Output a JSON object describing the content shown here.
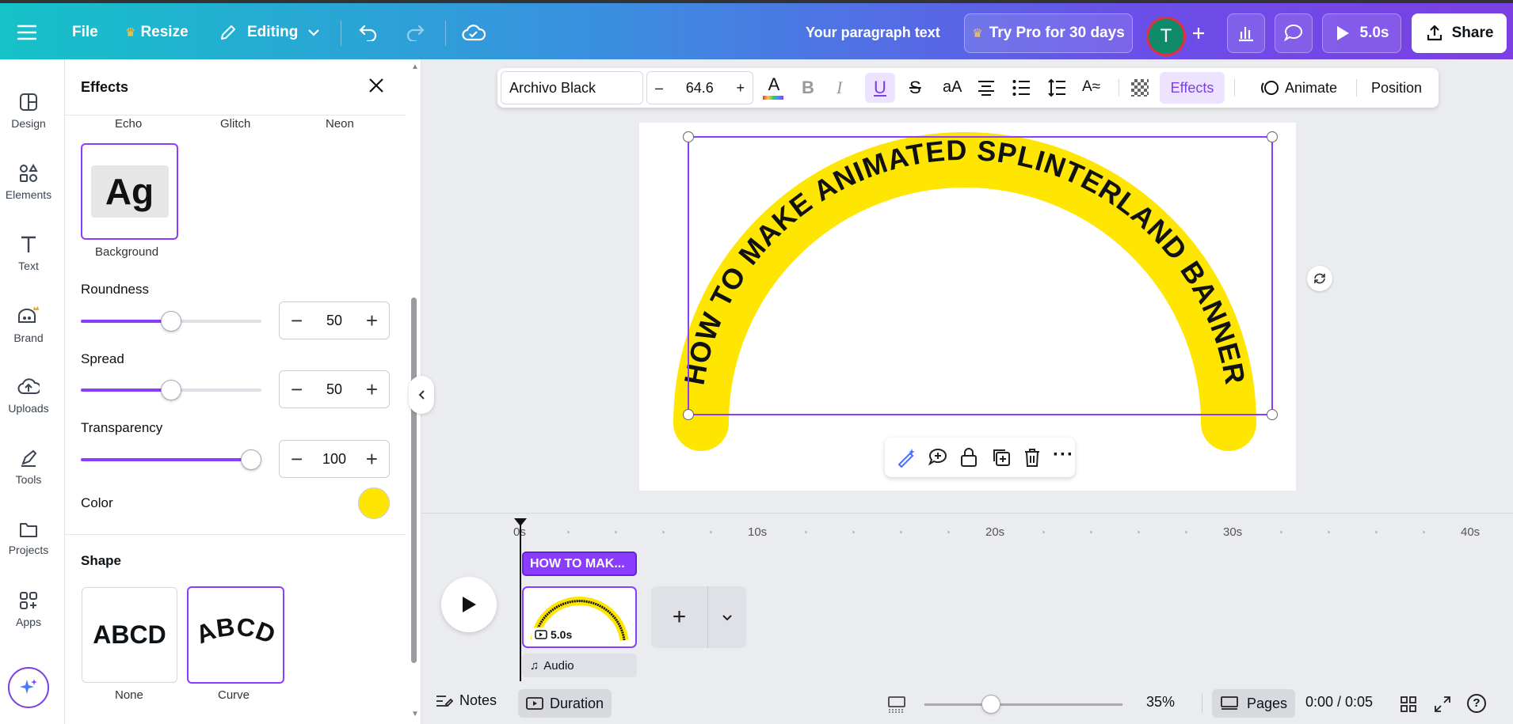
{
  "topbar": {
    "menu_icon": "hamburger-icon",
    "file_label": "File",
    "resize_label": "Resize",
    "editing_label": "Editing",
    "doc_title": "Your paragraph text",
    "try_pro_label": "Try Pro for 30 days",
    "avatar_letter": "T",
    "play_duration": "5.0s",
    "share_label": "Share"
  },
  "rail": {
    "items": [
      {
        "label": "Design",
        "icon": "design-icon"
      },
      {
        "label": "Elements",
        "icon": "elements-icon"
      },
      {
        "label": "Text",
        "icon": "text-icon"
      },
      {
        "label": "Brand",
        "icon": "brand-icon"
      },
      {
        "label": "Uploads",
        "icon": "uploads-icon"
      },
      {
        "label": "Tools",
        "icon": "tools-icon"
      },
      {
        "label": "Projects",
        "icon": "projects-icon"
      },
      {
        "label": "Apps",
        "icon": "apps-icon"
      }
    ]
  },
  "panel": {
    "title": "Effects",
    "styles_row": [
      "Echo",
      "Glitch",
      "Neon"
    ],
    "selected_style_preview": "Ag",
    "selected_style_label": "Background",
    "roundness": {
      "label": "Roundness",
      "value": "50",
      "level": 0.5
    },
    "spread": {
      "label": "Spread",
      "value": "50",
      "level": 0.5
    },
    "transparency": {
      "label": "Transparency",
      "value": "100",
      "level": 1.0
    },
    "color_label": "Color",
    "color_value": "#ffe600",
    "shape_title": "Shape",
    "shapes": [
      {
        "preview": "ABCD",
        "label": "None"
      },
      {
        "preview": "ABCD",
        "label": "Curve"
      }
    ]
  },
  "textbar": {
    "font": "Archivo Black",
    "size": "64.6",
    "effects_label": "Effects",
    "animate_label": "Animate",
    "position_label": "Position"
  },
  "canvas": {
    "curved_text": "HOW TO MAKE ANIMATED SPLINTERLAND BANNER",
    "highlight_color": "#ffe600"
  },
  "timeline": {
    "ticks": [
      "0s",
      "10s",
      "20s",
      "30s",
      "40s"
    ],
    "text_track_label": "HOW TO MAK...",
    "clip_duration": "5.0s",
    "audio_label": "Audio"
  },
  "bottombar": {
    "notes_label": "Notes",
    "duration_label": "Duration",
    "zoom": "35%",
    "pages_label": "Pages",
    "time": "0:00 / 0:05"
  }
}
